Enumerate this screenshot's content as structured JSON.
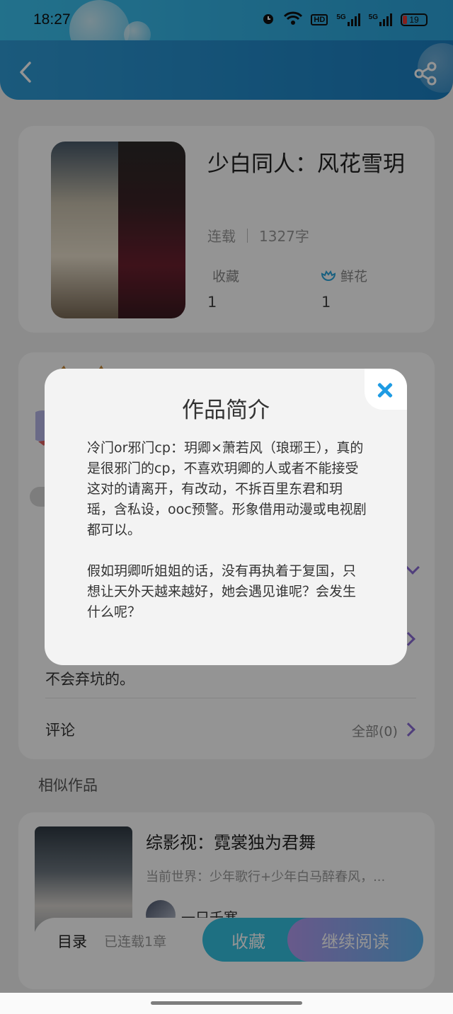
{
  "status_bar": {
    "time": "18:27",
    "icons": [
      "alarm-icon",
      "wifi-icon",
      "hd-icon",
      "5g-signal-icon",
      "5g-signal-icon"
    ],
    "hd": "HD",
    "net1": "5G",
    "net2": "5G",
    "battery": "19"
  },
  "book": {
    "title": "少白同人：风花雪玥",
    "status": "连载",
    "word_count": "1327字",
    "favorites_label": "收藏",
    "favorites_count": "1",
    "flowers_label": "鲜花",
    "flowers_count": "1"
  },
  "intro_card": {
    "tail_text": "不会弃坑的。",
    "comments_label": "评论",
    "comments_all": "全部(0)"
  },
  "similar": {
    "section_label": "相似作品",
    "title": "综影视：霓裳独为君舞",
    "subtitle": "当前世界：少年歌行+少年白马醉春风，...",
    "author": "一只千寒"
  },
  "bottom_bar": {
    "toc_label": "目录",
    "chapters_label": "已连载1章",
    "collect_label": "收藏",
    "read_label": "继续阅读"
  },
  "modal": {
    "title": "作品简介",
    "paragraph1": "冷门or邪门cp：玥卿×萧若风（琅琊王），真的是很邪门的cp，不喜欢玥卿的人或者不能接受这对的请离开，有改动，不拆百里东君和玥瑶，含私设，ooc预警。形象借用动漫或电视剧都可以。",
    "paragraph2": "假如玥卿听姐姐的话，没有再执着于复国，只想让天外天越来越好，她会遇见谁呢？会发生什么呢？"
  },
  "colors": {
    "accent_blue": "#1e9be3",
    "purple_chevron": "#8a6bd6",
    "collect_button": "#35c1e0"
  }
}
